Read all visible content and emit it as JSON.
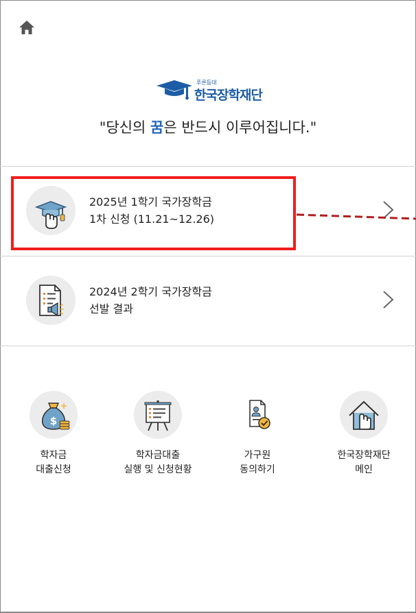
{
  "header": {
    "home_icon": "home-icon",
    "logo_sub": "푸른등대",
    "logo_name": "한국장학재단",
    "slogan_before": "\"당신의 ",
    "slogan_highlight": "꿈",
    "slogan_after": "은 반드시 이루어집니다.\""
  },
  "notices": [
    {
      "icon": "graduation-hand-icon",
      "line1": "2025년 1학기 국가장학금",
      "line2": "1차 신청 (11.21~12.26)",
      "highlighted": true
    },
    {
      "icon": "document-megaphone-icon",
      "line1": "2024년 2학기 국가장학금",
      "line2": "선발 결과",
      "highlighted": false
    }
  ],
  "quick_menu": [
    {
      "icon": "money-bag-icon",
      "label": "학자금\n대출신청"
    },
    {
      "icon": "presentation-board-icon",
      "label": "학자금대출\n실행 및 신청현황"
    },
    {
      "icon": "document-check-icon",
      "label": "가구원\n동의하기"
    },
    {
      "icon": "house-hand-icon",
      "label": "한국장학재단\n메인"
    }
  ],
  "colors": {
    "brand_blue": "#1d5da6",
    "highlight_red": "#f01d1d",
    "annotation_dash": "#b01e1e",
    "icon_bg": "#ececec"
  }
}
